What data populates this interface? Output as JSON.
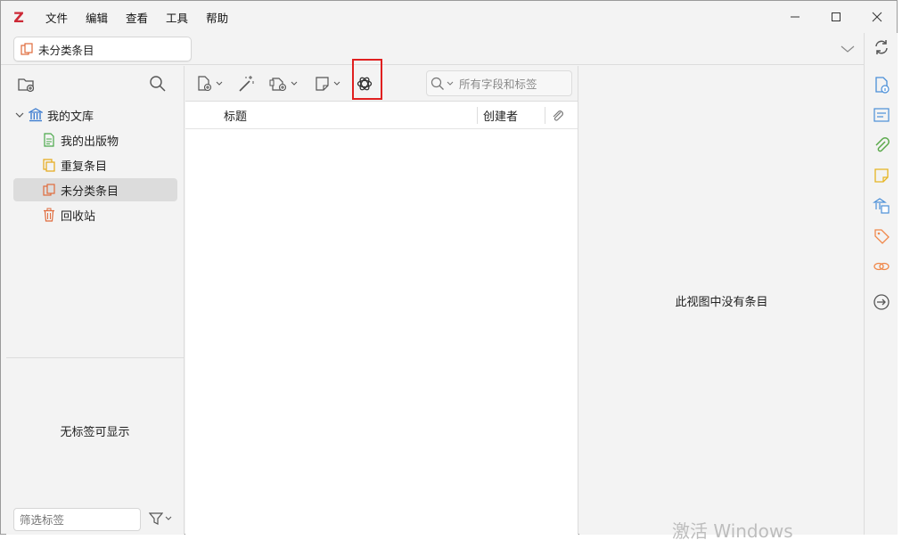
{
  "app": {
    "menu": [
      "文件",
      "编辑",
      "查看",
      "工具",
      "帮助"
    ]
  },
  "tab": {
    "label": "未分类条目"
  },
  "collections": [
    {
      "label": "我的文库"
    },
    {
      "label": "我的出版物"
    },
    {
      "label": "重复条目"
    },
    {
      "label": "未分类条目"
    },
    {
      "label": "回收站"
    }
  ],
  "tags": {
    "empty_message": "无标签可显示",
    "filter_placeholder": "筛选标签"
  },
  "items_toolbar": {
    "search_placeholder": "所有字段和标签"
  },
  "columns": {
    "title": "标题",
    "creator": "创建者"
  },
  "item_pane": {
    "empty_message": "此视图中没有条目"
  },
  "watermark": "激活 Windows",
  "colors": {
    "highlight_border": "#e02020",
    "zotero_red": "#cc2936",
    "selected_row": "#dcdcdc"
  }
}
